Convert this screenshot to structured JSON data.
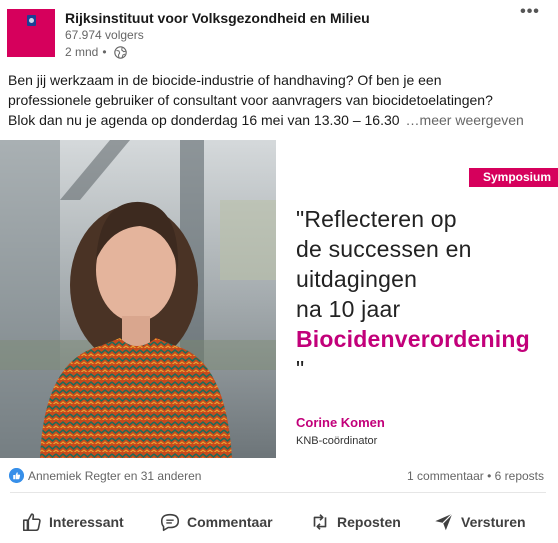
{
  "post": {
    "author": {
      "name": "Rijksinstituut voor Volksgezondheid en Milieu",
      "followers": "67.974 volgers",
      "time": "2 mnd",
      "separator": "•",
      "visibility_icon": "globe-icon",
      "logo_color": "#d6005c"
    },
    "more_icon": "more-icon",
    "text_lines": [
      "Ben jij werkzaam in de biocide-industrie of handhaving? Of ben je een",
      "professionele gebruiker of consultant voor aanvragers van biocidetoelatingen?",
      "Blok dan nu je agenda op donderdag 16 mei van 13.30 – 16.30"
    ],
    "see_more": "…meer weergeven"
  },
  "image": {
    "badge": "Symposium",
    "quote_lines": [
      "\"Reflecteren op",
      "de successen en",
      "uitdagingen",
      "na 10 jaar"
    ],
    "quote_accent": "Biocidenverordening",
    "quote_close": "\"",
    "speaker_name": "Corine Komen",
    "speaker_role": "KNB-coördinator",
    "accent_color": "#c2007a"
  },
  "social": {
    "reactions_text": "Annemiek Regter en 31 anderen",
    "reaction_icon": "like-icon",
    "comments": "1 commentaar",
    "dot": "•",
    "reposts": "6 reposts"
  },
  "actions": [
    {
      "label": "Interessant",
      "icon": "thumbs-up-icon"
    },
    {
      "label": "Commentaar",
      "icon": "comment-icon"
    },
    {
      "label": "Reposten",
      "icon": "repost-icon"
    },
    {
      "label": "Versturen",
      "icon": "send-icon"
    }
  ]
}
